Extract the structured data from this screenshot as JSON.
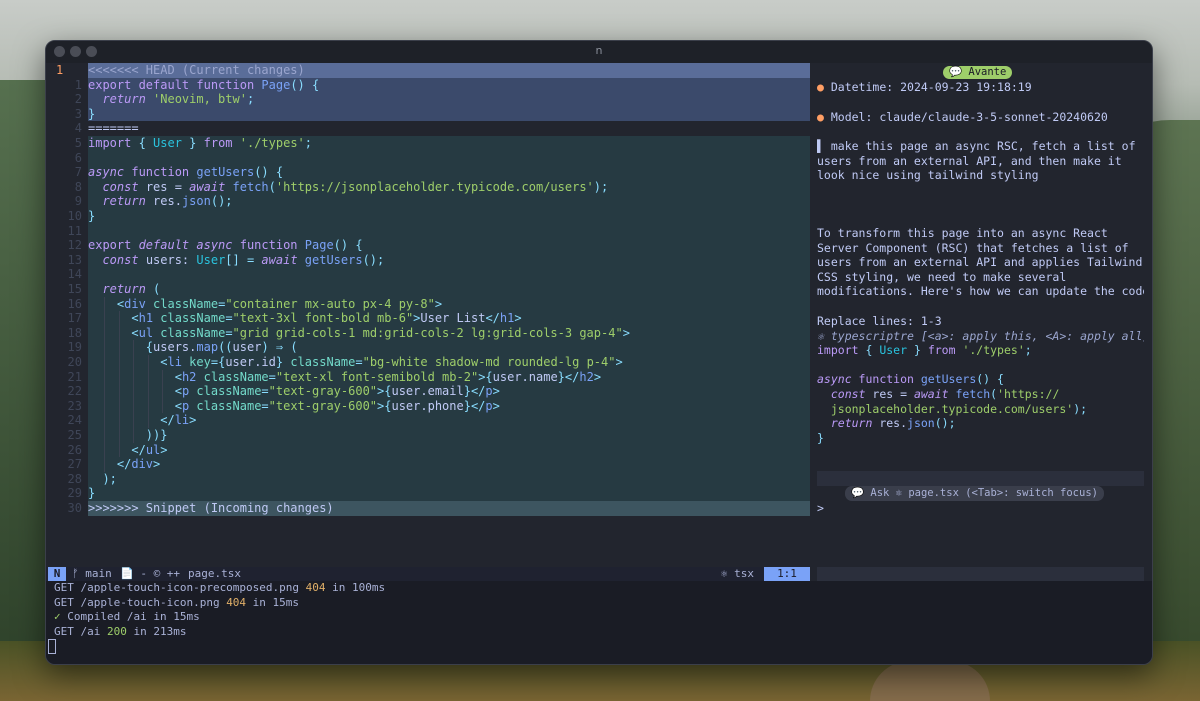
{
  "window": {
    "title": "n"
  },
  "editor": {
    "current_line": "1",
    "lines": [
      {
        "n": "",
        "k": "head-marker",
        "segs": [
          [
            "com",
            "<<<<<<< HEAD (Current changes)"
          ]
        ]
      },
      {
        "n": "1",
        "k": "head",
        "segs": [
          [
            "kw",
            "export "
          ],
          [
            "kw",
            "default "
          ],
          [
            "kw",
            "function "
          ],
          [
            "fn",
            "Page"
          ],
          [
            "pun",
            "() {"
          ]
        ]
      },
      {
        "n": "2",
        "k": "head",
        "segs": [
          [
            "var",
            "  "
          ],
          [
            "kwi",
            "return "
          ],
          [
            "str",
            "'Neovim, btw'"
          ],
          [
            "pun",
            ";"
          ]
        ]
      },
      {
        "n": "3",
        "k": "head",
        "segs": [
          [
            "pun",
            "}"
          ]
        ]
      },
      {
        "n": "4",
        "k": "sep",
        "segs": [
          [
            "var",
            "======="
          ]
        ]
      },
      {
        "n": "5",
        "k": "inc",
        "segs": [
          [
            "kw",
            "import "
          ],
          [
            "pun",
            "{ "
          ],
          [
            "ty",
            "User"
          ],
          [
            "pun",
            " } "
          ],
          [
            "kw",
            "from "
          ],
          [
            "str",
            "'./types'"
          ],
          [
            "pun",
            ";"
          ]
        ]
      },
      {
        "n": "6",
        "k": "inc",
        "segs": []
      },
      {
        "n": "7",
        "k": "inc",
        "segs": [
          [
            "kwi",
            "async "
          ],
          [
            "kw",
            "function "
          ],
          [
            "fn",
            "getUsers"
          ],
          [
            "pun",
            "() {"
          ]
        ]
      },
      {
        "n": "8",
        "k": "inc",
        "segs": [
          [
            "var",
            "  "
          ],
          [
            "kwi",
            "const "
          ],
          [
            "var",
            "res = "
          ],
          [
            "kwi",
            "await "
          ],
          [
            "fn",
            "fetch"
          ],
          [
            "pun",
            "("
          ],
          [
            "str",
            "'https://jsonplaceholder.typicode.com/users'"
          ],
          [
            "pun",
            ");"
          ]
        ]
      },
      {
        "n": "9",
        "k": "inc",
        "segs": [
          [
            "var",
            "  "
          ],
          [
            "kwi",
            "return "
          ],
          [
            "var",
            "res."
          ],
          [
            "fn",
            "json"
          ],
          [
            "pun",
            "();"
          ]
        ]
      },
      {
        "n": "10",
        "k": "inc",
        "segs": [
          [
            "pun",
            "}"
          ]
        ]
      },
      {
        "n": "11",
        "k": "inc",
        "segs": []
      },
      {
        "n": "12",
        "k": "inc",
        "segs": [
          [
            "kw",
            "export "
          ],
          [
            "kwi",
            "default "
          ],
          [
            "kwi",
            "async "
          ],
          [
            "kw",
            "function "
          ],
          [
            "fn",
            "Page"
          ],
          [
            "pun",
            "() {"
          ]
        ]
      },
      {
        "n": "13",
        "k": "inc",
        "segs": [
          [
            "var",
            "  "
          ],
          [
            "kwi",
            "const "
          ],
          [
            "var",
            "users: "
          ],
          [
            "ty",
            "User"
          ],
          [
            "pun",
            "[] = "
          ],
          [
            "kwi",
            "await "
          ],
          [
            "fn",
            "getUsers"
          ],
          [
            "pun",
            "();"
          ]
        ]
      },
      {
        "n": "14",
        "k": "inc",
        "segs": []
      },
      {
        "n": "15",
        "k": "inc",
        "segs": [
          [
            "var",
            "  "
          ],
          [
            "kwi",
            "return "
          ],
          [
            "pun",
            "("
          ]
        ]
      },
      {
        "n": "16",
        "k": "inc",
        "segs": [
          [
            "var",
            "    "
          ],
          [
            "pun",
            "<"
          ],
          [
            "tag",
            "div "
          ],
          [
            "attr",
            "className"
          ],
          [
            "pun",
            "="
          ],
          [
            "str",
            "\"container mx-auto px-4 py-8\""
          ],
          [
            "pun",
            ">"
          ]
        ]
      },
      {
        "n": "17",
        "k": "inc",
        "segs": [
          [
            "var",
            "      "
          ],
          [
            "pun",
            "<"
          ],
          [
            "tag",
            "h1 "
          ],
          [
            "attr",
            "className"
          ],
          [
            "pun",
            "="
          ],
          [
            "str",
            "\"text-3xl font-bold mb-6\""
          ],
          [
            "pun",
            ">"
          ],
          [
            "var",
            "User List"
          ],
          [
            "pun",
            "</"
          ],
          [
            "tag",
            "h1"
          ],
          [
            "pun",
            ">"
          ]
        ]
      },
      {
        "n": "18",
        "k": "inc",
        "segs": [
          [
            "var",
            "      "
          ],
          [
            "pun",
            "<"
          ],
          [
            "tag",
            "ul "
          ],
          [
            "attr",
            "className"
          ],
          [
            "pun",
            "="
          ],
          [
            "str",
            "\"grid grid-cols-1 md:grid-cols-2 lg:grid-cols-3 gap-4\""
          ],
          [
            "pun",
            ">"
          ]
        ]
      },
      {
        "n": "19",
        "k": "inc",
        "segs": [
          [
            "var",
            "        "
          ],
          [
            "pun",
            "{"
          ],
          [
            "var",
            "users."
          ],
          [
            "fn",
            "map"
          ],
          [
            "pun",
            "(("
          ],
          [
            "var",
            "user"
          ],
          [
            "pun",
            ") ⇒ ("
          ]
        ]
      },
      {
        "n": "20",
        "k": "inc",
        "segs": [
          [
            "var",
            "          "
          ],
          [
            "pun",
            "<"
          ],
          [
            "tag",
            "li "
          ],
          [
            "attr",
            "key"
          ],
          [
            "pun",
            "={"
          ],
          [
            "var",
            "user.id"
          ],
          [
            "pun",
            "} "
          ],
          [
            "attr",
            "className"
          ],
          [
            "pun",
            "="
          ],
          [
            "str",
            "\"bg-white shadow-md rounded-lg p-4\""
          ],
          [
            "pun",
            ">"
          ]
        ]
      },
      {
        "n": "21",
        "k": "inc",
        "segs": [
          [
            "var",
            "            "
          ],
          [
            "pun",
            "<"
          ],
          [
            "tag",
            "h2 "
          ],
          [
            "attr",
            "className"
          ],
          [
            "pun",
            "="
          ],
          [
            "str",
            "\"text-xl font-semibold mb-2\""
          ],
          [
            "pun",
            ">{"
          ],
          [
            "var",
            "user.name"
          ],
          [
            "pun",
            "}</"
          ],
          [
            "tag",
            "h2"
          ],
          [
            "pun",
            ">"
          ]
        ]
      },
      {
        "n": "22",
        "k": "inc",
        "segs": [
          [
            "var",
            "            "
          ],
          [
            "pun",
            "<"
          ],
          [
            "tag",
            "p "
          ],
          [
            "attr",
            "className"
          ],
          [
            "pun",
            "="
          ],
          [
            "str",
            "\"text-gray-600\""
          ],
          [
            "pun",
            ">{"
          ],
          [
            "var",
            "user.email"
          ],
          [
            "pun",
            "}</"
          ],
          [
            "tag",
            "p"
          ],
          [
            "pun",
            ">"
          ]
        ]
      },
      {
        "n": "23",
        "k": "inc",
        "segs": [
          [
            "var",
            "            "
          ],
          [
            "pun",
            "<"
          ],
          [
            "tag",
            "p "
          ],
          [
            "attr",
            "className"
          ],
          [
            "pun",
            "="
          ],
          [
            "str",
            "\"text-gray-600\""
          ],
          [
            "pun",
            ">{"
          ],
          [
            "var",
            "user.phone"
          ],
          [
            "pun",
            "}</"
          ],
          [
            "tag",
            "p"
          ],
          [
            "pun",
            ">"
          ]
        ]
      },
      {
        "n": "24",
        "k": "inc",
        "segs": [
          [
            "var",
            "          "
          ],
          [
            "pun",
            "</"
          ],
          [
            "tag",
            "li"
          ],
          [
            "pun",
            ">"
          ]
        ]
      },
      {
        "n": "25",
        "k": "inc",
        "segs": [
          [
            "var",
            "        "
          ],
          [
            "pun",
            "))}"
          ]
        ]
      },
      {
        "n": "26",
        "k": "inc",
        "segs": [
          [
            "var",
            "      "
          ],
          [
            "pun",
            "</"
          ],
          [
            "tag",
            "ul"
          ],
          [
            "pun",
            ">"
          ]
        ]
      },
      {
        "n": "27",
        "k": "inc",
        "segs": [
          [
            "var",
            "    "
          ],
          [
            "pun",
            "</"
          ],
          [
            "tag",
            "div"
          ],
          [
            "pun",
            ">"
          ]
        ]
      },
      {
        "n": "28",
        "k": "inc",
        "segs": [
          [
            "var",
            "  "
          ],
          [
            "pun",
            ");"
          ]
        ]
      },
      {
        "n": "29",
        "k": "inc",
        "segs": [
          [
            "pun",
            "}"
          ]
        ]
      },
      {
        "n": "30",
        "k": "inc-marker",
        "segs": [
          [
            "var",
            ">>>>>>> Snippet (Incoming changes)"
          ]
        ]
      }
    ]
  },
  "statusline": {
    "mode": "N",
    "branch": "ᚠ main",
    "icons": "📄 -  © ++",
    "filename": "page.tsx",
    "filetype": "⚛ tsx",
    "position": "1:1"
  },
  "sidebar": {
    "badge": "💬 Avante",
    "datetime": "Datetime: 2024-09-23 19:18:19",
    "model": "Model: claude/claude-3-5-sonnet-20240620",
    "prompt_lines": [
      "make this page an async RSC, fetch a list of",
      "users from an external API, and then make it",
      "look nice using tailwind styling"
    ],
    "answer_lines": [
      "To transform this page into an async React",
      "Server Component (RSC) that fetches a list of",
      "users from an external API and applies Tailwind",
      "CSS styling, we need to make several",
      "modifications. Here's how we can update the code:"
    ],
    "replace_label": "Replace lines: 1-3",
    "snippet_hint": "⚛ typescriptre [<a>: apply this, <A>: apply all]",
    "snippet": [
      [
        [
          "kw",
          "import "
        ],
        [
          "pun",
          "{ "
        ],
        [
          "ty",
          "User"
        ],
        [
          "pun",
          " } "
        ],
        [
          "kw",
          "from "
        ],
        [
          "str",
          "'./types'"
        ],
        [
          "pun",
          ";"
        ]
      ],
      [],
      [
        [
          "kwi",
          "async "
        ],
        [
          "kw",
          "function "
        ],
        [
          "fn",
          "getUsers"
        ],
        [
          "pun",
          "() {"
        ]
      ],
      [
        [
          "var",
          "  "
        ],
        [
          "kwi",
          "const "
        ],
        [
          "var",
          "res = "
        ],
        [
          "kwi",
          "await "
        ],
        [
          "fn",
          "fetch"
        ],
        [
          "pun",
          "("
        ],
        [
          "str",
          "'https://"
        ]
      ],
      [
        [
          "str",
          "  jsonplaceholder.typicode.com/users'"
        ],
        [
          "pun",
          ");"
        ]
      ],
      [
        [
          "var",
          "  "
        ],
        [
          "kwi",
          "return "
        ],
        [
          "var",
          "res."
        ],
        [
          "fn",
          "json"
        ],
        [
          "pun",
          "();"
        ]
      ],
      [
        [
          "pun",
          "}"
        ]
      ]
    ],
    "ask_label": "💬 Ask ⚛ page.tsx (<Tab>: switch focus)",
    "input_prompt": ">"
  },
  "terminal": {
    "lines": [
      [
        [
          "t",
          "GET /apple-touch-icon-precomposed.png "
        ],
        [
          "n404",
          "404"
        ],
        [
          "t",
          " in 100ms"
        ]
      ],
      [
        [
          "t",
          "GET /apple-touch-icon.png "
        ],
        [
          "n404",
          "404"
        ],
        [
          "t",
          " in 15ms"
        ]
      ],
      [
        [
          "n200",
          "✓"
        ],
        [
          "t",
          " Compiled /ai in 15ms"
        ]
      ],
      [
        [
          "t",
          "GET /ai "
        ],
        [
          "n200",
          "200"
        ],
        [
          "t",
          " in 213ms"
        ]
      ]
    ]
  }
}
